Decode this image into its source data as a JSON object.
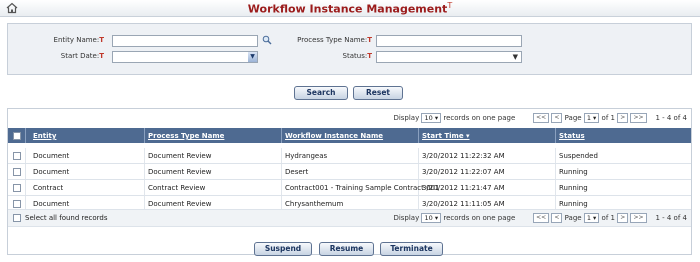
{
  "header": {
    "title": "Workflow Instance Management",
    "required_mark": "T",
    "home_icon": "home-icon"
  },
  "filter": {
    "entity_name_label": "Entity Name:",
    "process_type_name_label": "Process Type Name:",
    "start_date_label": "Start Date:",
    "status_label": "Status:",
    "required_mark": "T",
    "entity_name_value": "",
    "process_type_name_value": "",
    "start_date_value": "",
    "status_value": ""
  },
  "actions": {
    "search": "Search",
    "reset": "Reset"
  },
  "pager_top": {
    "display": "Display",
    "per_page": "10",
    "records_text": "records on one page",
    "first": "<<",
    "prev": "<",
    "page_label": "Page",
    "page": "1",
    "of": "of 1",
    "next": ">",
    "last": ">>",
    "range": "1 - 4 of 4"
  },
  "table": {
    "columns": [
      "Entity",
      "Process Type Name",
      "Workflow Instance Name",
      "Start Time",
      "Status"
    ],
    "sort_indicator": "▾",
    "rows": [
      {
        "entity": "Document",
        "process": "Document Review",
        "name": "Hydrangeas",
        "start": "3/20/2012 11:22:32 AM",
        "status": "Suspended"
      },
      {
        "entity": "Document",
        "process": "Document Review",
        "name": "Desert",
        "start": "3/20/2012 11:22:07 AM",
        "status": "Running"
      },
      {
        "entity": "Contract",
        "process": "Contract Review",
        "name": "Contract001 - Training Sample Contract 001",
        "start": "3/20/2012 11:21:47 AM",
        "status": "Running"
      },
      {
        "entity": "Document",
        "process": "Document Review",
        "name": "Chrysanthemum",
        "start": "3/20/2012 11:11:05 AM",
        "status": "Running"
      }
    ],
    "select_all": "Select all found records"
  },
  "pager_bottom": {
    "display": "Display",
    "per_page": "10",
    "records_text": "records on one page",
    "first": "<<",
    "prev": "<",
    "page_label": "Page",
    "page": "1",
    "of": "of 1",
    "next": ">",
    "last": ">>",
    "range": "1 - 4 of 4"
  },
  "bottom_actions": {
    "suspend": "Suspend",
    "resume": "Resume",
    "terminate": "Terminate"
  }
}
